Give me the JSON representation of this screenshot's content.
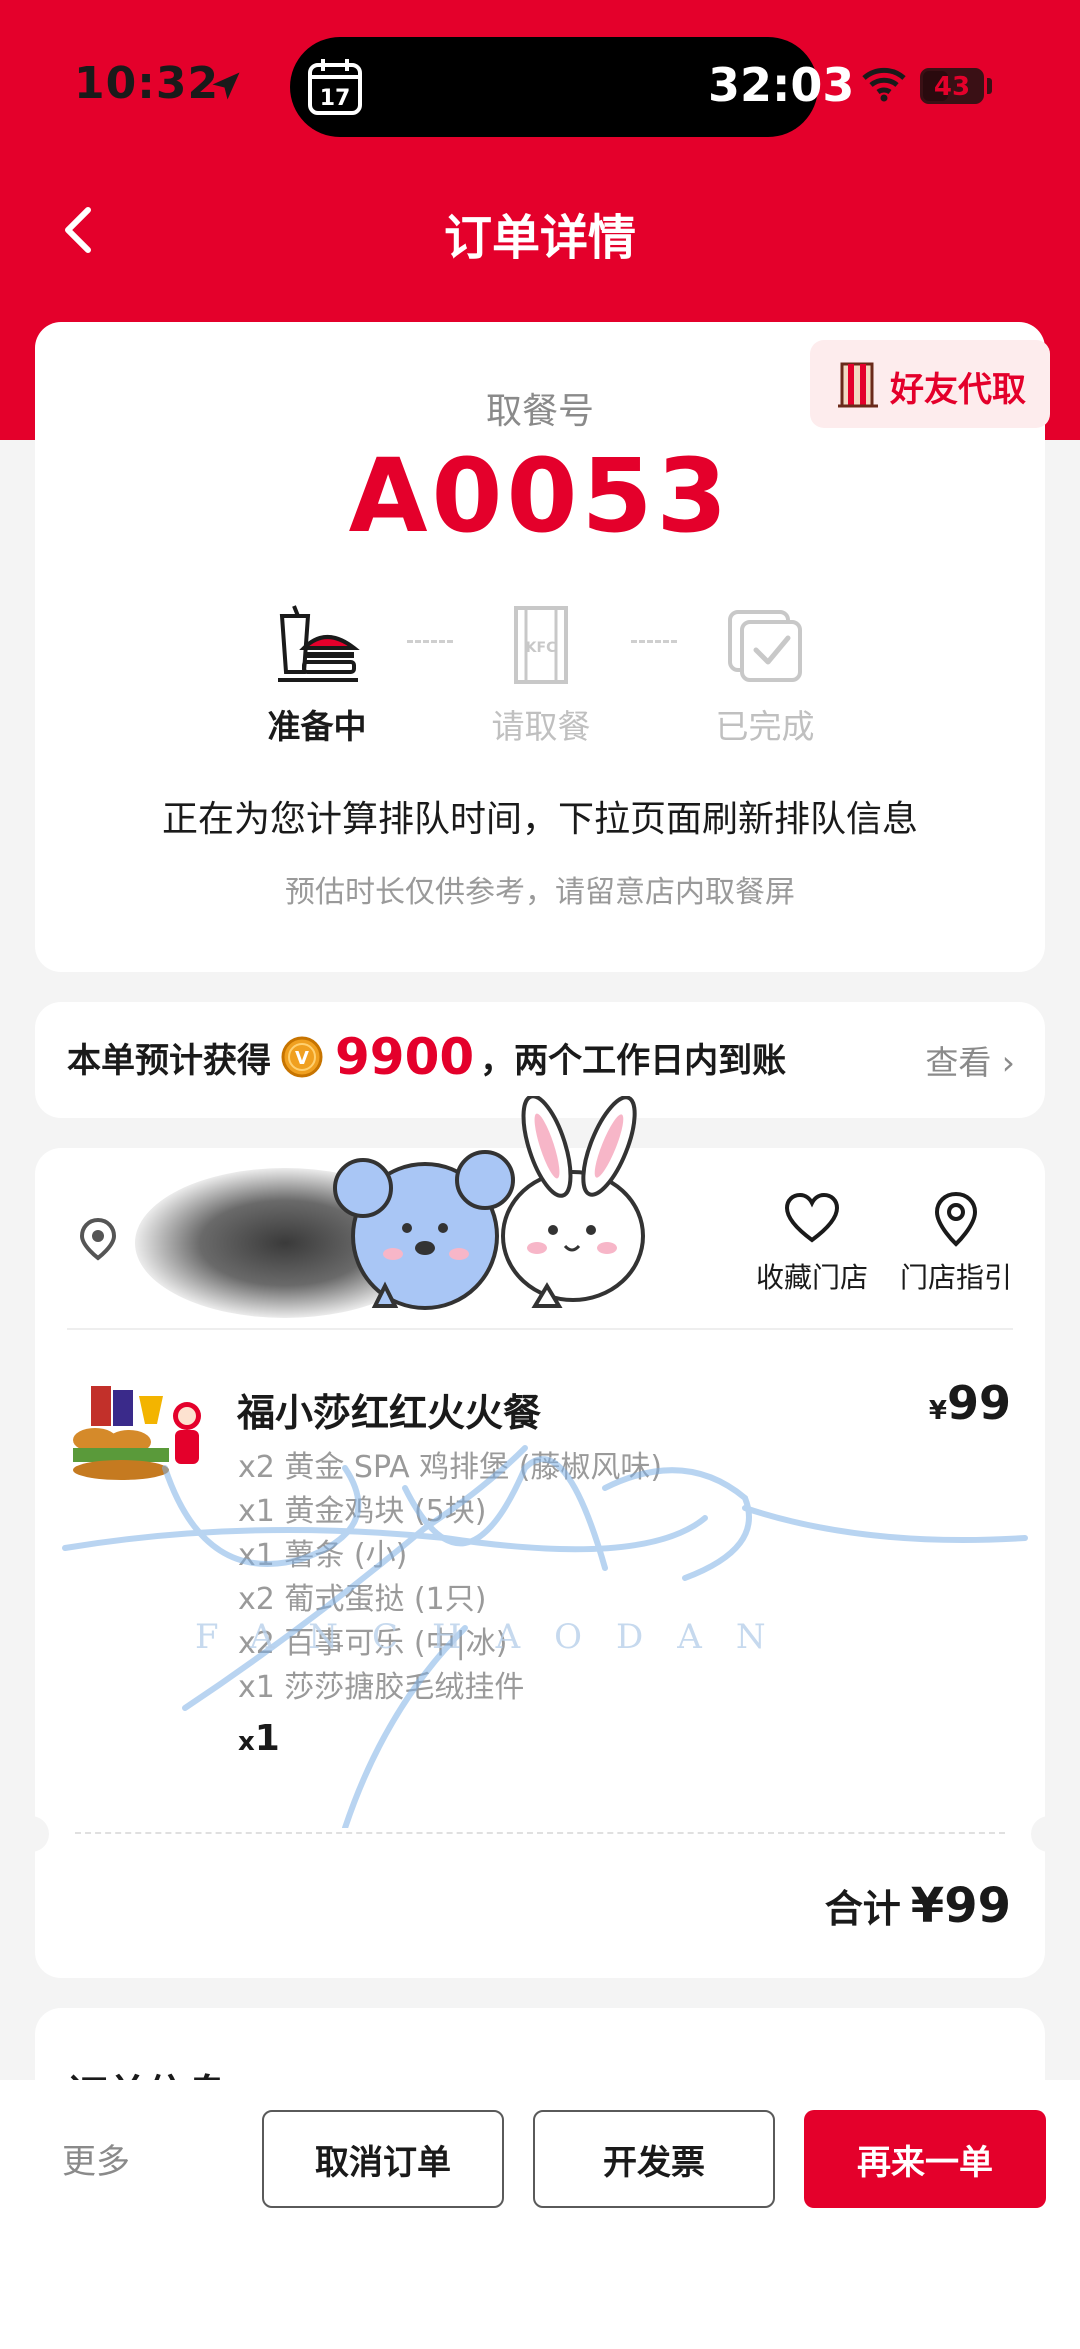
{
  "status_bar": {
    "time": "10:32",
    "calendar_day": "17",
    "timer": "32:03",
    "battery_level": "43"
  },
  "nav": {
    "title": "订单详情"
  },
  "pickup": {
    "friend_pickup_label": "好友代取",
    "label": "取餐号",
    "number": "A0053",
    "steps": [
      {
        "label": "准备中",
        "active": true
      },
      {
        "label": "请取餐",
        "active": false
      },
      {
        "label": "已完成",
        "active": false
      }
    ],
    "queue_message": "正在为您计算排队时间，下拉页面刷新排队信息",
    "queue_note": "预估时长仅供参考，请留意店内取餐屏"
  },
  "points": {
    "prefix": "本单预计获得",
    "value": "9900",
    "suffix": "，两个工作日内到账",
    "view_label": "查看 ›"
  },
  "store": {
    "favorite_label": "收藏门店",
    "guide_label": "门店指引"
  },
  "meal": {
    "name": "福小莎红红火火餐",
    "price_symbol": "¥",
    "price": "99",
    "items": [
      "x2 黄金 SPA 鸡排堡 (藤椒风味)",
      "x1 黄金鸡块 (5块)",
      "x1 薯条 (小)",
      "x2 葡式蛋挞 (1只)",
      "x2 百事可乐 (中|冰)",
      "x1 莎莎搪胶毛绒挂件"
    ],
    "qty_prefix": "x",
    "qty": "1",
    "total_label": "合计",
    "total_value": "¥99"
  },
  "order_info": {
    "title": "订单信息"
  },
  "bottom": {
    "more_label": "更多",
    "cancel_label": "取消订单",
    "invoice_label": "开发票",
    "reorder_label": "再来一单"
  },
  "colors": {
    "brand_red": "#e4002b",
    "gray_text": "#9a9a9a"
  }
}
